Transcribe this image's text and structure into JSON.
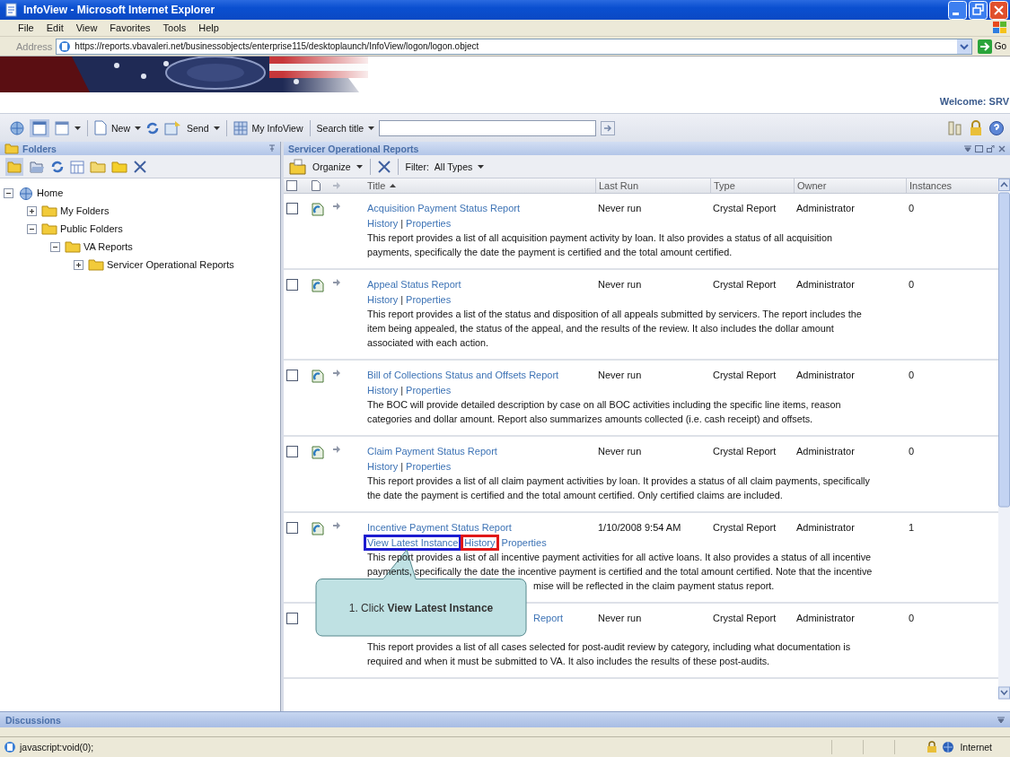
{
  "window": {
    "title": "InfoView - Microsoft Internet Explorer"
  },
  "menu": [
    "File",
    "Edit",
    "View",
    "Favorites",
    "Tools",
    "Help"
  ],
  "address_bar": {
    "label": "Address",
    "url": "https://reports.vbavaleri.net/businessobjects/enterprise115/desktoplaunch/InfoView/logon/logon.object",
    "go": "Go"
  },
  "banner": {
    "welcome": "Welcome: SRV"
  },
  "toolbar": {
    "new": "New",
    "send": "Send",
    "my_infoview": "My InfoView",
    "search_label": "Search title"
  },
  "folders_panel": {
    "title": "Folders",
    "tree": [
      {
        "label": "Home",
        "kind": "home",
        "expanded": true,
        "children": [
          {
            "label": "My Folders",
            "kind": "folder",
            "expanded": false
          },
          {
            "label": "Public Folders",
            "kind": "folder",
            "expanded": true,
            "children": [
              {
                "label": "VA Reports",
                "kind": "folder",
                "expanded": true,
                "children": [
                  {
                    "label": "Servicer Operational Reports",
                    "kind": "folder",
                    "expanded": false
                  }
                ]
              }
            ]
          }
        ]
      }
    ]
  },
  "reports_panel": {
    "title": "Servicer Operational Reports",
    "organize": "Organize",
    "filter_label": "Filter:",
    "filter_value": "All Types",
    "select_all_checked": false,
    "columns": [
      "Title",
      "Last Run",
      "Type",
      "Owner",
      "Instances"
    ],
    "rows": [
      {
        "title": "Acquisition Payment Status Report",
        "last_run": "Never run",
        "type": "Crystal Report",
        "owner": "Administrator",
        "instances": "0",
        "checked": false,
        "links": [
          {
            "kind": "history",
            "label": "History"
          },
          {
            "kind": "separator",
            "label": "|"
          },
          {
            "kind": "properties",
            "label": "Properties"
          }
        ],
        "description": [
          "This report provides a list of all acquisition payment activity by loan. It also provides a status of all acquisition",
          "payments, specifically the date the payment is certified and the total amount certified."
        ]
      },
      {
        "title": "Appeal Status Report",
        "last_run": "Never run",
        "type": "Crystal Report",
        "owner": "Administrator",
        "instances": "0",
        "checked": false,
        "links": [
          {
            "kind": "history",
            "label": "History"
          },
          {
            "kind": "separator",
            "label": "|"
          },
          {
            "kind": "properties",
            "label": "Properties"
          }
        ],
        "description": [
          "This report provides a list of the status and disposition of all appeals submitted by servicers. The report includes the",
          "item being appealed, the status of the appeal, and the results of the review. It also includes the dollar amount",
          "associated with each action."
        ]
      },
      {
        "title": "Bill of Collections Status and Offsets Report",
        "last_run": "Never run",
        "type": "Crystal Report",
        "owner": "Administrator",
        "instances": "0",
        "checked": false,
        "links": [
          {
            "kind": "history",
            "label": "History"
          },
          {
            "kind": "separator",
            "label": "|"
          },
          {
            "kind": "properties",
            "label": "Properties"
          }
        ],
        "description": [
          "The BOC will provide detailed description by case on all BOC activities including the specific line items, reason",
          "categories and dollar amount. Report also summarizes amounts collected (i.e. cash receipt) and offsets."
        ]
      },
      {
        "title": "Claim Payment Status Report",
        "last_run": "Never run",
        "type": "Crystal Report",
        "owner": "Administrator",
        "instances": "0",
        "checked": false,
        "links": [
          {
            "kind": "history",
            "label": "History"
          },
          {
            "kind": "separator",
            "label": "|"
          },
          {
            "kind": "properties",
            "label": "Properties"
          }
        ],
        "description": [
          "This report provides a list of all claim payment activities by loan. It provides a status of all claim payments, specifically",
          "the date the payment is certified and the total amount certified. Only certified claims are included."
        ]
      },
      {
        "title": "Incentive Payment Status Report",
        "last_run": "1/10/2008 9:54 AM",
        "type": "Crystal Report",
        "owner": "Administrator",
        "instances": "1",
        "checked": false,
        "links": [
          {
            "kind": "view-latest-instance",
            "label": "View Latest Instance",
            "color": "#1c1cd0"
          },
          {
            "kind": "history",
            "label": "History",
            "color": "#e01818"
          },
          {
            "kind": "properties",
            "label": "Properties"
          }
        ],
        "description": [
          "This report provides a list of all incentive payment activities for all active loans. It also provides a status of all incentive",
          "payments, specifically the date the incentive payment is certified and the total amount certified. Note that the incentive"
        ],
        "description_tail": "mise will be reflected in the claim payment status report.",
        "callout": {
          "text": "1. Click **View Latest Instance**"
        }
      },
      {
        "title": "Report",
        "covered": true,
        "last_run": "Never run",
        "type": "Crystal Report",
        "owner": "Administrator",
        "instances": "0",
        "checked": false,
        "description": [
          "This report provides a list of all cases selected for post-audit review by category, including what documentation is",
          "required and when it must be submitted to VA. It also includes the results of these post-audits."
        ]
      }
    ]
  },
  "discussions": {
    "title": "Discussions"
  },
  "status_bar": {
    "text": "javascript:void(0);",
    "zone": "Internet"
  }
}
